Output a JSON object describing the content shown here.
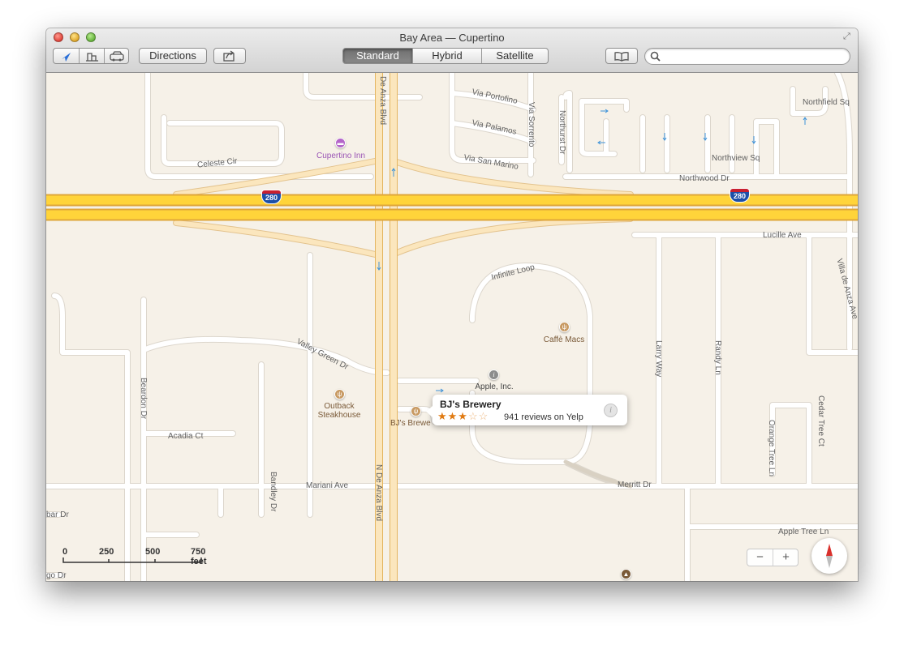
{
  "window": {
    "title": "Bay Area — Cupertino",
    "fullscreen_icon": "fullscreen-icon"
  },
  "toolbar": {
    "directions_label": "Directions",
    "segments": [
      "Standard",
      "Hybrid",
      "Satellite"
    ],
    "active_segment": "Standard",
    "search": {
      "value": "",
      "placeholder": ""
    },
    "icons": [
      "location-arrow-icon",
      "3d-buildings-icon",
      "traffic-car-icon",
      "share-icon",
      "bookmarks-icon",
      "search-icon"
    ]
  },
  "map": {
    "streets": {
      "de_anza_top": "De Anza Blvd",
      "n_de_anza": "N De Anza Blvd",
      "celeste": "Celeste Cir",
      "via_portofino": "Via Portofino",
      "via_palamos": "Via Palamos",
      "via_san_marino": "Via San Marino",
      "via_sorrento": "Via Sorrento",
      "northurst": "Northurst Dr",
      "northfield": "Northfield Sq",
      "northview": "Northview Sq",
      "northwood": "Northwood Dr",
      "lucille": "Lucille Ave",
      "villa_de_anza": "Villa de Anza Ave",
      "infinite_loop": "Infinite Loop",
      "valley_green": "Valley Green Dr",
      "beardon": "Beardon Dr",
      "acadia": "Acadia Ct",
      "bandley": "Bandley Dr",
      "mariani": "Mariani Ave",
      "larry": "Larry Way",
      "randy": "Randy Ln",
      "orange_tree": "Orange Tree Ln",
      "cedar_tree": "Cedar Tree Ct",
      "apple_tree": "Apple Tree Ln",
      "merritt": "Merritt Dr",
      "bar_dr": "bar Dr",
      "go_dr": "go Dr"
    },
    "highway_shield": "280",
    "pois": {
      "cupertino_inn": "Cupertino Inn",
      "caffe_macs": "Caffè Macs",
      "apple_inc": "Apple, Inc.",
      "outback_1": "Outback",
      "outback_2": "Steakhouse",
      "bjs_label": "BJ's Brewe"
    },
    "callout": {
      "name": "BJ's Brewery",
      "rating": 3,
      "max_rating": 5,
      "stars_on": "★★★",
      "stars_off": "☆☆",
      "reviews": "941 reviews on Yelp"
    },
    "scale": {
      "ticks": [
        "0",
        "250",
        "500",
        "750 feet"
      ]
    },
    "zoom": {
      "minus": "−",
      "plus": "+"
    }
  },
  "colors": {
    "land": "#f6f1e8",
    "street": "#ffffff",
    "highway": "#ffd43a",
    "highway_edge": "#e4a93a",
    "ramp": "#fbe6bd",
    "poi_food": "#c89a63",
    "poi_hotel": "#b466c9",
    "poi_info": "#8c8c8c",
    "callout_star": "#e07a12",
    "shield_red": "#c8202f",
    "shield_blue": "#1d4fa8"
  }
}
